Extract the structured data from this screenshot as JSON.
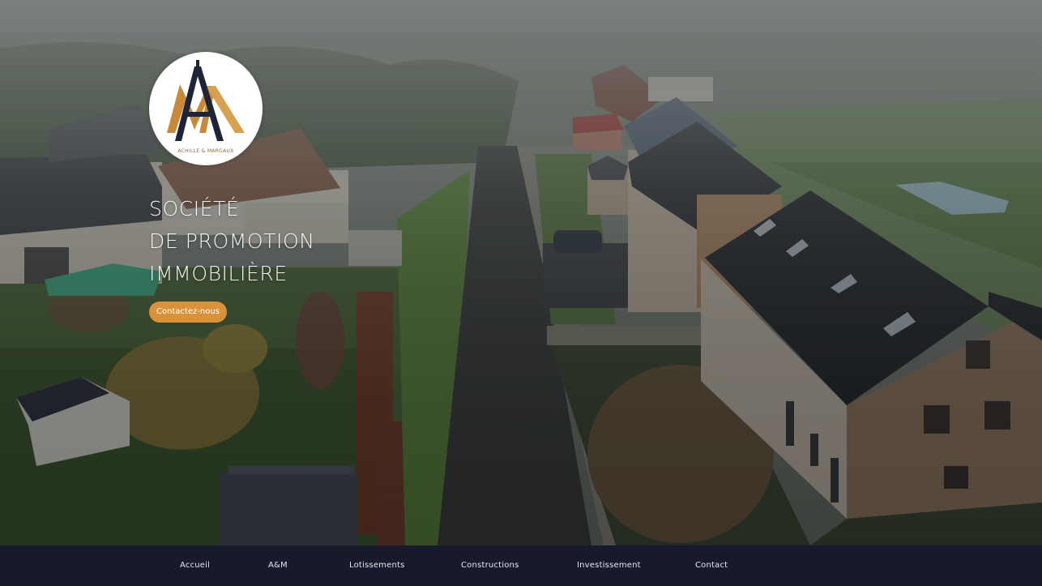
{
  "brand": {
    "logo_caption": "ACHILLE & MARGAUX",
    "accent_color": "#d9913a",
    "logo_gold": "#c8893a",
    "logo_navy": "#1f2538"
  },
  "hero": {
    "headline_line1": "SOCIÉTÉ",
    "headline_line2": "DE PROMOTION",
    "headline_line3": "IMMOBILIÈRE",
    "cta_label": "Contactez-nous"
  },
  "nav": {
    "background": "#161a2c",
    "items": [
      {
        "label": "Accueil"
      },
      {
        "label": "A&M"
      },
      {
        "label": "Lotissements"
      },
      {
        "label": "Constructions"
      },
      {
        "label": "Investissement"
      },
      {
        "label": "Contact"
      }
    ]
  }
}
